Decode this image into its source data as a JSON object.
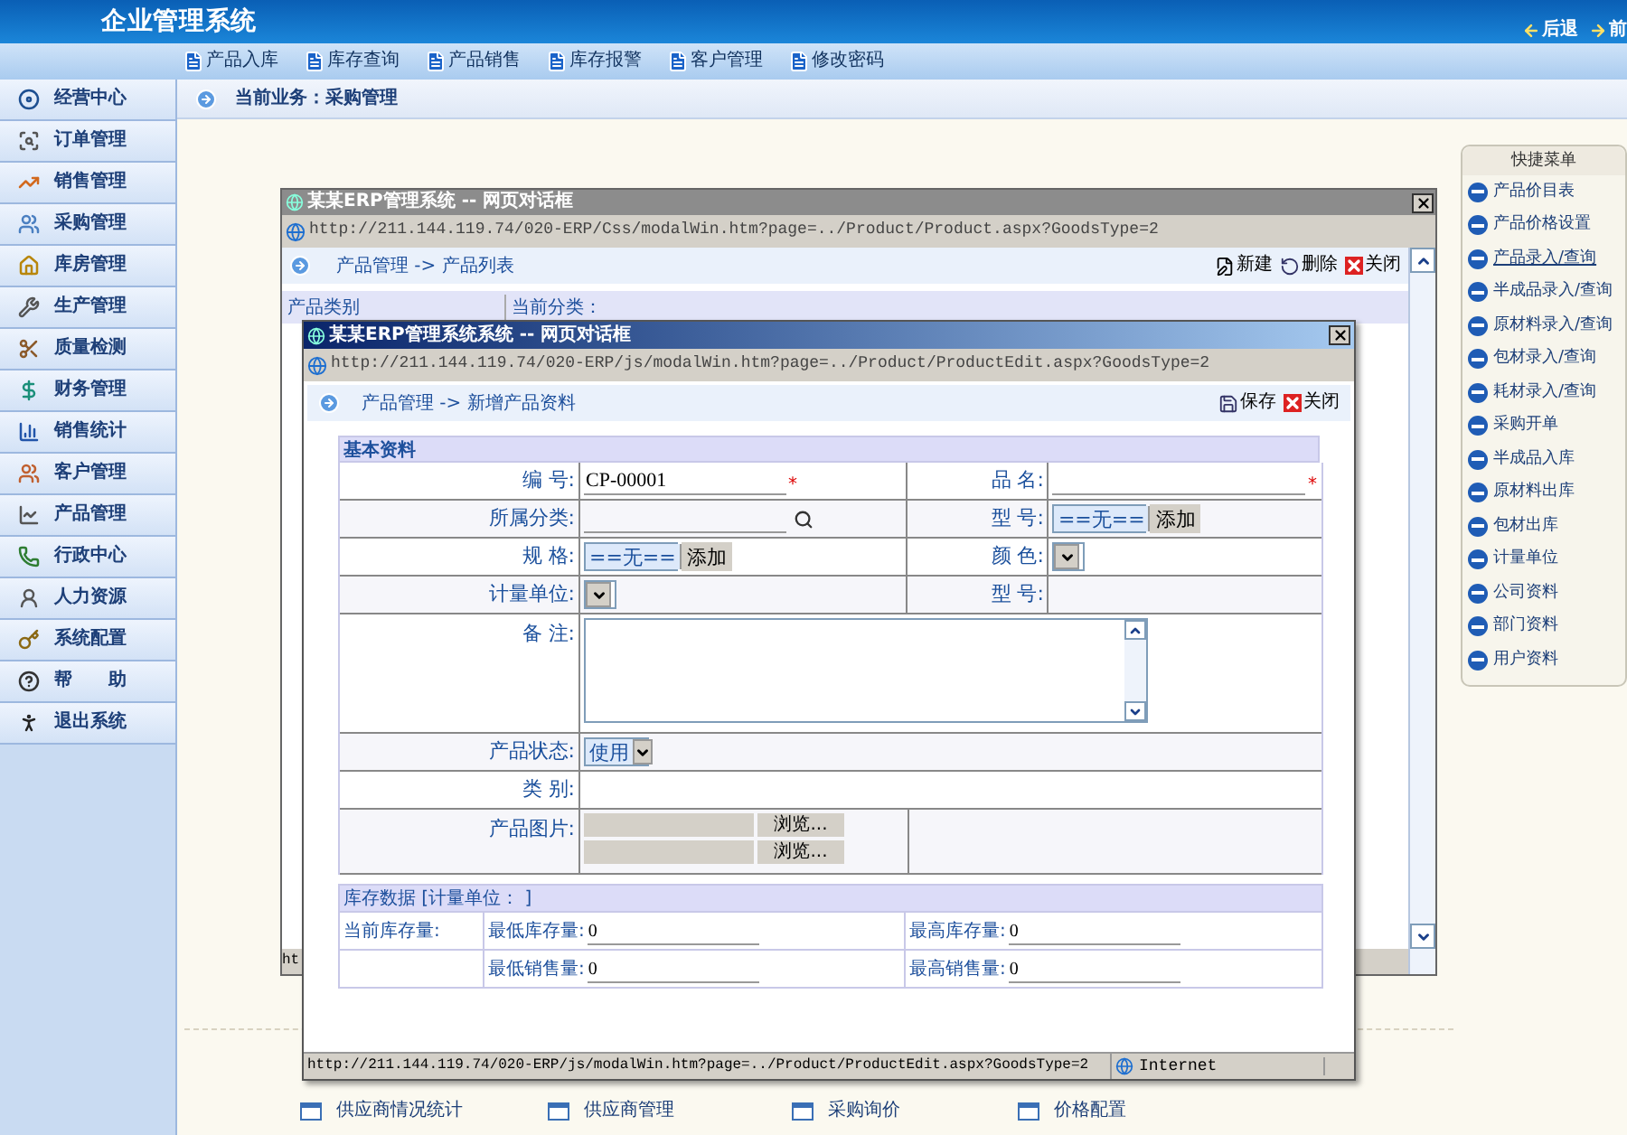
{
  "app": {
    "title": "企业管理系统",
    "nav": [
      "后退",
      "前"
    ]
  },
  "toolbar": [
    "产品入库",
    "库存查询",
    "产品销售",
    "库存报警",
    "客户管理",
    "修改密码"
  ],
  "sidebar": {
    "items": [
      "经营中心",
      "订单管理",
      "销售管理",
      "采购管理",
      "库房管理",
      "生产管理",
      "质量检测",
      "财务管理",
      "销售统计",
      "客户管理",
      "产品管理",
      "行政中心",
      "人力资源",
      "系统配置",
      "帮　　助",
      "退出系统"
    ]
  },
  "breadcrumb": "当前业务：采购管理",
  "quick_menu": {
    "title": "快捷菜单",
    "items": [
      {
        "label": "产品价目表",
        "hovered": false
      },
      {
        "label": "产品价格设置",
        "hovered": false
      },
      {
        "label": "产品录入/查询",
        "hovered": true
      },
      {
        "label": "半成品录入/查询",
        "hovered": false
      },
      {
        "label": "原材料录入/查询",
        "hovered": false
      },
      {
        "label": "包材录入/查询",
        "hovered": false
      },
      {
        "label": "耗材录入/查询",
        "hovered": false
      },
      {
        "label": "采购开单",
        "hovered": false
      },
      {
        "label": "半成品入库",
        "hovered": false
      },
      {
        "label": "原材料出库",
        "hovered": false
      },
      {
        "label": "包材出库",
        "hovered": false
      },
      {
        "label": "计量单位",
        "hovered": false
      },
      {
        "label": "公司资料",
        "hovered": false
      },
      {
        "label": "部门资料",
        "hovered": false
      },
      {
        "label": "用户资料",
        "hovered": false
      }
    ]
  },
  "bottom_links": [
    "供应商情况统计",
    "供应商管理",
    "采购询价",
    "价格配置"
  ],
  "dialog_back": {
    "title": "某某ERP管理系统 -- 网页对话框",
    "address": "http://211.144.119.74/020-ERP/Css/modalWin.htm?page=../Product/Product.aspx?GoodsType=2",
    "breadcrumb": "产品管理 -> 产品列表",
    "actions": [
      "新建",
      "删除",
      "关闭"
    ],
    "columns": [
      "产品类别",
      "当前分类："
    ],
    "status": "ht"
  },
  "dialog_front": {
    "title": "某某ERP管理系统系统 -- 网页对话框",
    "address": "http://211.144.119.74/020-ERP/js/modalWin.htm?page=../Product/ProductEdit.aspx?GoodsType=2",
    "breadcrumb": "产品管理 -> 新增产品资料",
    "actions": [
      "保存",
      "关闭"
    ],
    "basic": {
      "title": "基本资料",
      "rows": [
        [
          {
            "label": "编 号:",
            "kind": "text",
            "value": "CP-00001",
            "mark": "*"
          },
          {
            "label": "品 名:",
            "kind": "text",
            "mark": "*"
          }
        ],
        [
          {
            "label": "所属分类:",
            "kind": "search"
          },
          {
            "label": "型 号:",
            "kind": "select",
            "value": "==无==",
            "button": "添加"
          }
        ],
        [
          {
            "label": "规 格:",
            "kind": "select",
            "value": "==无==",
            "button": "添加"
          },
          {
            "label": "颜 色:",
            "kind": "select"
          }
        ],
        [
          {
            "label": "计量单位:",
            "kind": "select"
          },
          {
            "label": "型 号:",
            "kind": "blank"
          }
        ],
        [
          {
            "label": "备 注:",
            "kind": "textarea"
          }
        ],
        [
          {
            "label": "产品状态:",
            "kind": "select",
            "value": "使用"
          }
        ],
        [
          {
            "label": "类 别:",
            "kind": "blank"
          }
        ],
        [
          {
            "label": "产品图片:",
            "kind": "files",
            "buttons": [
              "浏览...",
              "浏览..."
            ]
          },
          {
            "kind": "empty"
          }
        ]
      ]
    },
    "stock": {
      "title": "库存数据 [计量单位： ]",
      "rows": [
        {
          "label": "当前库存量:",
          "fields": [
            {
              "label": "最低库存量:",
              "value": "0"
            },
            {
              "label": "最高库存量:",
              "value": "0"
            }
          ]
        },
        {
          "fields": [
            {
              "label": "最低销售量:",
              "value": "0"
            },
            {
              "label": "最高销售量:",
              "value": "0"
            }
          ]
        }
      ]
    },
    "status": {
      "url": "http://211.144.119.74/020-ERP/js/modalWin.htm?page=../Product/ProductEdit.aspx?GoodsType=2",
      "zone": "Internet"
    }
  }
}
